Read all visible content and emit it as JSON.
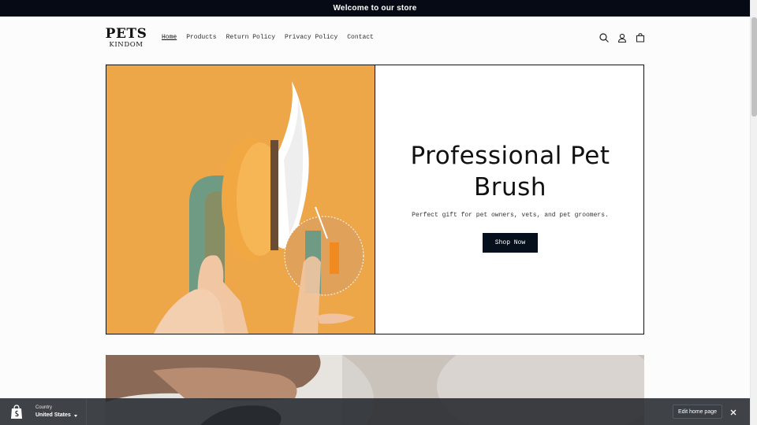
{
  "announcement": "Welcome to our store",
  "logo": {
    "line1": "PETS",
    "line2": "KINDOM"
  },
  "nav": [
    {
      "label": "Home",
      "active": true
    },
    {
      "label": "Products",
      "active": false
    },
    {
      "label": "Return Policy",
      "active": false
    },
    {
      "label": "Privacy Policy",
      "active": false
    },
    {
      "label": "Contact",
      "active": false
    }
  ],
  "header_icons": [
    "search-icon",
    "account-icon",
    "cart-icon"
  ],
  "hero": {
    "title": "Professional Pet Brush",
    "subtitle": "Perfect gift for pet owners, vets, and pet groomers.",
    "button": "Shop Now",
    "image_bg_color": "#eda648"
  },
  "second_section": {
    "partial_heading": ""
  },
  "bottom_bar": {
    "country_label": "Country",
    "country_value": "United States",
    "edit_button": "Edit home page"
  },
  "colors": {
    "announcement_bg": "#050a14",
    "button_bg": "#06101c",
    "bar_bg": "#24282d"
  }
}
